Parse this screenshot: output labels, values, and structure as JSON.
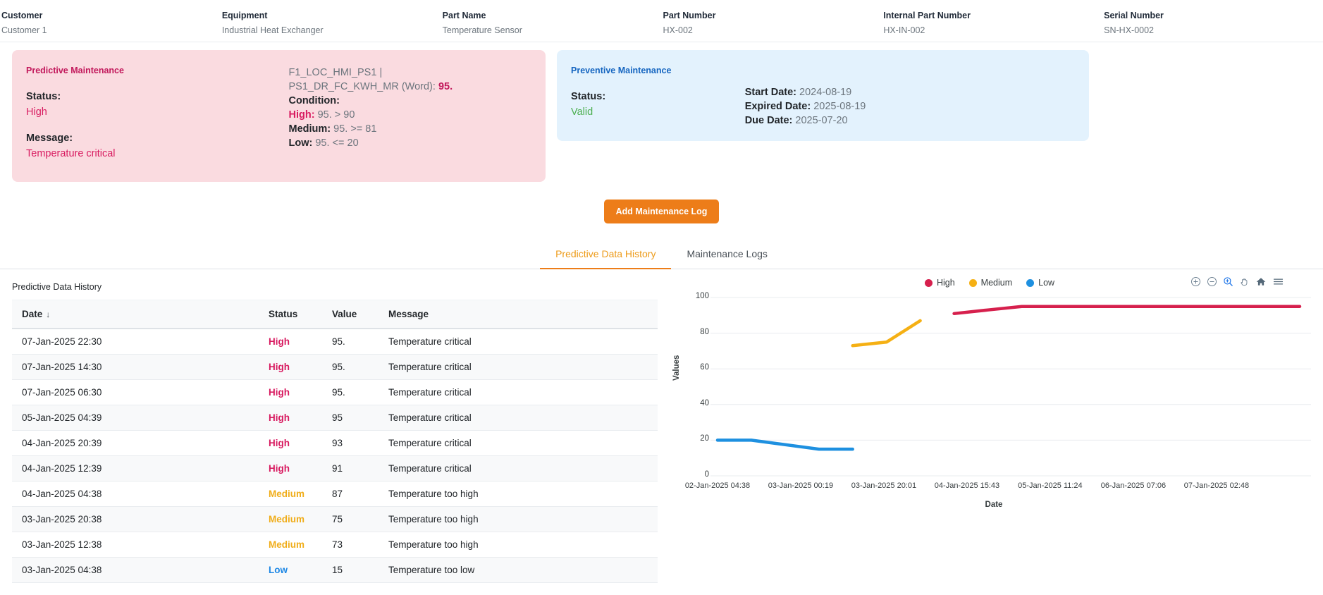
{
  "header_fields": [
    {
      "label": "Customer",
      "value": "Customer 1"
    },
    {
      "label": "Equipment",
      "value": "Industrial Heat Exchanger"
    },
    {
      "label": "Part Name",
      "value": "Temperature Sensor"
    },
    {
      "label": "Part Number",
      "value": "HX-002"
    },
    {
      "label": "Internal Part Number",
      "value": "HX-IN-002"
    },
    {
      "label": "Serial Number",
      "value": "SN-HX-0002"
    }
  ],
  "predictive_card": {
    "title": "Predictive Maintenance",
    "status_label": "Status:",
    "status_value": "High",
    "message_label": "Message:",
    "message_value": "Temperature critical",
    "tag_line1": "F1_LOC_HMI_PS1 |",
    "tag_line2_prefix": "PS1_DR_FC_KWH_MR (Word): ",
    "tag_line2_value": "95.",
    "condition_label": "Condition:",
    "conditions": [
      {
        "label": "High:",
        "expr": " 95. > 90",
        "level": "high"
      },
      {
        "label": "Medium:",
        "expr": " 95. >= 81",
        "level": "medium"
      },
      {
        "label": "Low:",
        "expr": " 95. <= 20",
        "level": "low"
      }
    ]
  },
  "preventive_card": {
    "title": "Preventive Maintenance",
    "status_label": "Status:",
    "status_value": "Valid",
    "dates": [
      {
        "label": "Start Date:",
        "value": " 2024-08-19"
      },
      {
        "label": "Expired Date:",
        "value": " 2025-08-19"
      },
      {
        "label": "Due Date:",
        "value": " 2025-07-20"
      }
    ]
  },
  "add_button_label": "Add Maintenance Log",
  "tabs": [
    {
      "label": "Predictive Data History",
      "active": true
    },
    {
      "label": "Maintenance Logs",
      "active": false
    }
  ],
  "table": {
    "caption": "Predictive Data History",
    "sort_indicator": "↓",
    "columns": [
      "Date",
      "Status",
      "Value",
      "Message"
    ],
    "rows": [
      {
        "date": "07-Jan-2025 22:30",
        "status": "High",
        "value": "95.",
        "message": "Temperature critical"
      },
      {
        "date": "07-Jan-2025 14:30",
        "status": "High",
        "value": "95.",
        "message": "Temperature critical"
      },
      {
        "date": "07-Jan-2025 06:30",
        "status": "High",
        "value": "95.",
        "message": "Temperature critical"
      },
      {
        "date": "05-Jan-2025 04:39",
        "status": "High",
        "value": "95",
        "message": "Temperature critical"
      },
      {
        "date": "04-Jan-2025 20:39",
        "status": "High",
        "value": "93",
        "message": "Temperature critical"
      },
      {
        "date": "04-Jan-2025 12:39",
        "status": "High",
        "value": "91",
        "message": "Temperature critical"
      },
      {
        "date": "04-Jan-2025 04:38",
        "status": "Medium",
        "value": "87",
        "message": "Temperature too high"
      },
      {
        "date": "03-Jan-2025 20:38",
        "status": "Medium",
        "value": "75",
        "message": "Temperature too high"
      },
      {
        "date": "03-Jan-2025 12:38",
        "status": "Medium",
        "value": "73",
        "message": "Temperature too high"
      },
      {
        "date": "03-Jan-2025 04:38",
        "status": "Low",
        "value": "15",
        "message": "Temperature too low"
      }
    ]
  },
  "chart_toolbar": [
    "zoom-in-icon",
    "zoom-out-icon",
    "selection-zoom-icon",
    "pan-icon",
    "home-icon",
    "menu-icon"
  ],
  "chart_data": {
    "type": "line",
    "title": "",
    "xlabel": "Date",
    "ylabel": "Values",
    "ylim": [
      0,
      100
    ],
    "yticks": [
      0,
      20,
      40,
      60,
      80,
      100
    ],
    "xticks": [
      "02-Jan-2025 04:38",
      "03-Jan-2025 00:19",
      "03-Jan-2025 20:01",
      "04-Jan-2025 15:43",
      "05-Jan-2025 11:24",
      "06-Jan-2025 07:06",
      "07-Jan-2025 02:48"
    ],
    "grid": true,
    "legend_position": "top-center",
    "colors": {
      "High": "#d6204d",
      "Medium": "#f5b014",
      "Low": "#1e90e0"
    },
    "series": [
      {
        "name": "Low",
        "color": "#1e90e0",
        "points": [
          {
            "x": "02-Jan-2025 04:38",
            "y": 20
          },
          {
            "x": "02-Jan-2025 12:38",
            "y": 20
          },
          {
            "x": "03-Jan-2025 04:38",
            "y": 15
          },
          {
            "x": "03-Jan-2025 12:38",
            "y": 15
          }
        ]
      },
      {
        "name": "Medium",
        "color": "#f5b014",
        "points": [
          {
            "x": "03-Jan-2025 12:38",
            "y": 73
          },
          {
            "x": "03-Jan-2025 20:38",
            "y": 75
          },
          {
            "x": "04-Jan-2025 04:38",
            "y": 87
          }
        ]
      },
      {
        "name": "High",
        "color": "#d6204d",
        "points": [
          {
            "x": "04-Jan-2025 12:39",
            "y": 91
          },
          {
            "x": "04-Jan-2025 20:39",
            "y": 93
          },
          {
            "x": "05-Jan-2025 04:39",
            "y": 95
          },
          {
            "x": "07-Jan-2025 06:30",
            "y": 95
          },
          {
            "x": "07-Jan-2025 22:30",
            "y": 95
          }
        ]
      }
    ],
    "legend": [
      {
        "label": "High",
        "color": "#d6204d"
      },
      {
        "label": "Medium",
        "color": "#f5b014"
      },
      {
        "label": "Low",
        "color": "#1e90e0"
      }
    ]
  }
}
